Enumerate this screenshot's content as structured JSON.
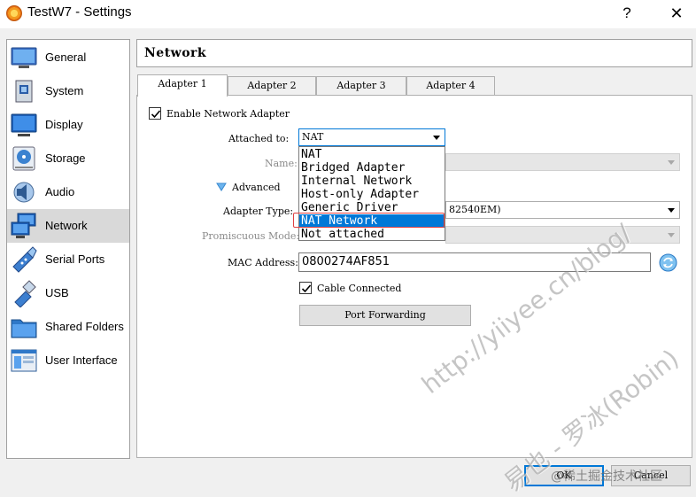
{
  "window": {
    "title": "TestW7 - Settings",
    "help_label": "?",
    "close_label": "✕"
  },
  "sidebar": {
    "items": [
      {
        "label": "General",
        "icon": "general-icon"
      },
      {
        "label": "System",
        "icon": "system-icon"
      },
      {
        "label": "Display",
        "icon": "display-icon"
      },
      {
        "label": "Storage",
        "icon": "storage-icon"
      },
      {
        "label": "Audio",
        "icon": "audio-icon"
      },
      {
        "label": "Network",
        "icon": "network-icon",
        "selected": true
      },
      {
        "label": "Serial Ports",
        "icon": "serial-ports-icon"
      },
      {
        "label": "USB",
        "icon": "usb-icon"
      },
      {
        "label": "Shared Folders",
        "icon": "shared-folders-icon"
      },
      {
        "label": "User Interface",
        "icon": "user-interface-icon"
      }
    ]
  },
  "section": {
    "title": "Network"
  },
  "tabs": [
    {
      "label": "Adapter 1",
      "active": true
    },
    {
      "label": "Adapter 2"
    },
    {
      "label": "Adapter 3"
    },
    {
      "label": "Adapter 4"
    }
  ],
  "adapter": {
    "enable_label": "Enable Network Adapter",
    "enable_checked": true,
    "attached_to_label": "Attached to:",
    "attached_to_value": "NAT",
    "name_label": "Name:",
    "advanced_label": "Advanced",
    "adapter_type_label": "Adapter Type:",
    "adapter_type_value_visible": "82540EM)",
    "promiscuous_label": "Promiscuous Mode:",
    "mac_label": "MAC Address:",
    "mac_value": "0800274AF851",
    "cable_label": "Cable Connected",
    "cable_checked": true,
    "port_forwarding_label": "Port Forwarding"
  },
  "dropdown": {
    "options": [
      "NAT",
      "Bridged Adapter",
      "Internal Network",
      "Host-only Adapter",
      "Generic Driver",
      "NAT Network",
      "Not attached"
    ],
    "highlighted": "NAT Network"
  },
  "footer": {
    "ok_label": "OK",
    "cancel_label": "Cancel"
  },
  "watermark": {
    "line1": "http://yiiyee.cn/blog/",
    "line2": "易也 - 罗冰(Robin)",
    "corner": "@稀土掘金技术社区"
  },
  "colors": {
    "accent": "#0078d7",
    "selection_bg": "#d9d9d9",
    "highlight_outline": "#e04040"
  }
}
